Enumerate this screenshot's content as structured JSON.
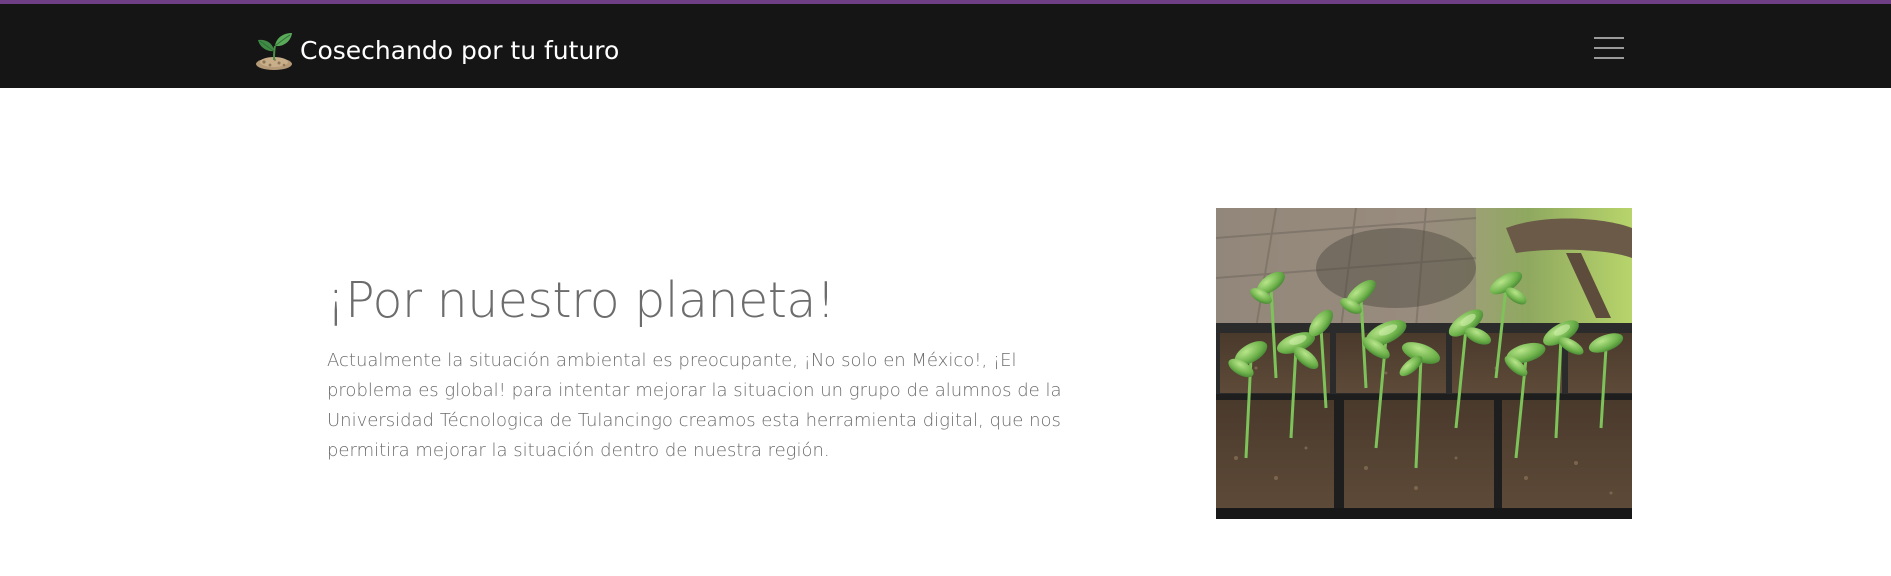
{
  "navbar": {
    "brand_text": "Cosechando por tu futuro",
    "brand_icon": "seedling-icon",
    "menu_icon": "hamburger-menu-icon",
    "accent_color": "#6f3f86",
    "background_color": "#151515"
  },
  "hero": {
    "title": "¡Por nuestro planeta!",
    "paragraph": "Actualmente la situación ambiental es preocupante, ¡No solo en México!, ¡El problema es global! para intentar mejorar la situacion un grupo de alumnos de la Universidad Técnologica de Tulancingo creamos esta herramienta digital, que nos permitira mejorar la situación dentro de nuestra región.",
    "image": "seedling-tray-photo",
    "text_color": "#6c6c6c"
  }
}
